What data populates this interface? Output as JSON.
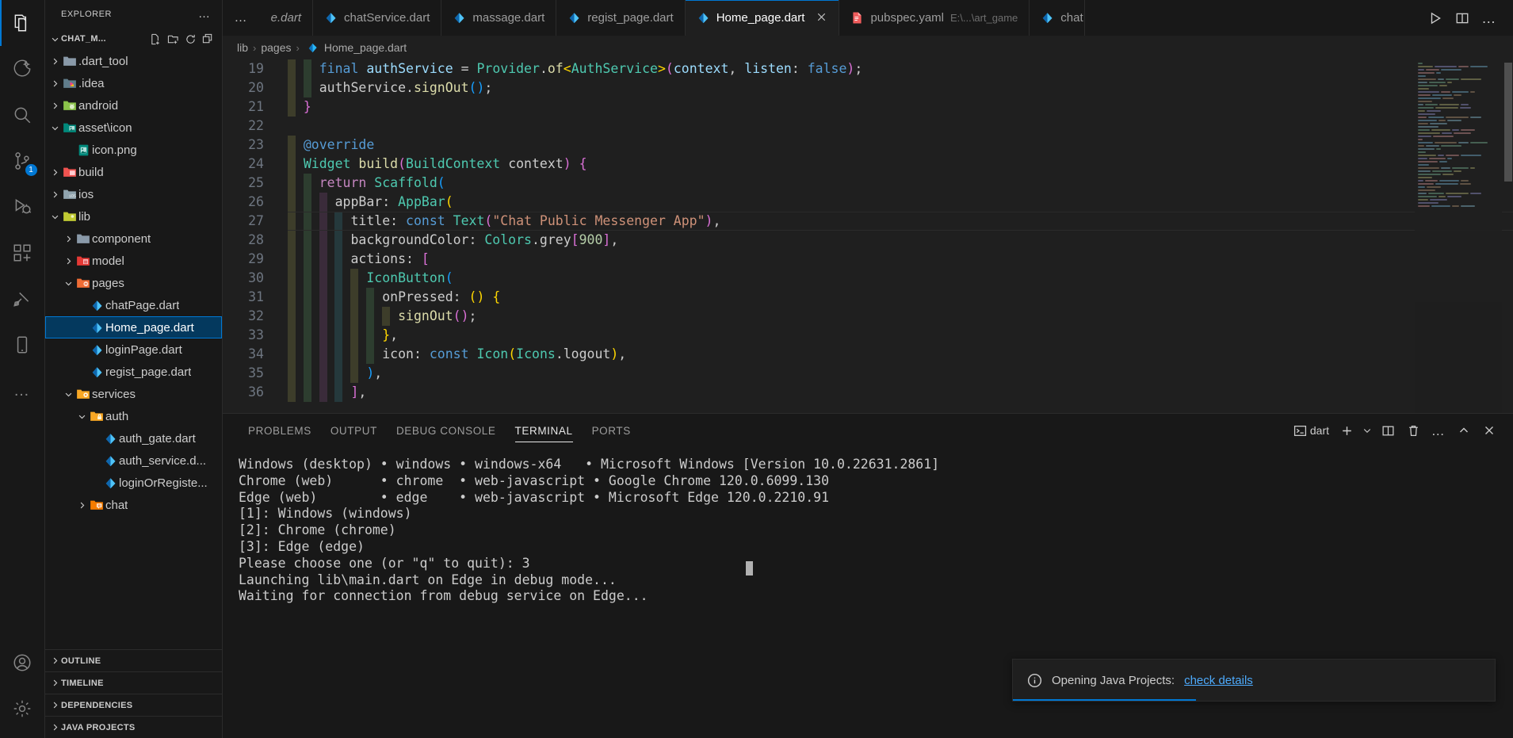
{
  "activitybar": {
    "items": [
      {
        "name": "explorer-icon",
        "active": true,
        "badge": ""
      },
      {
        "name": "github-copilot-icon",
        "active": false,
        "badge": ""
      },
      {
        "name": "search-icon",
        "active": false,
        "badge": ""
      },
      {
        "name": "source-control-icon",
        "active": false,
        "badge": "1"
      },
      {
        "name": "run-and-debug-icon",
        "active": false,
        "badge": ""
      },
      {
        "name": "extensions-icon",
        "active": false,
        "badge": ""
      },
      {
        "name": "testing-icon",
        "active": false,
        "badge": ""
      },
      {
        "name": "mobile-preview-icon",
        "active": false,
        "badge": ""
      },
      {
        "name": "more-views-icon",
        "active": false,
        "badge": ""
      }
    ],
    "bottom": [
      {
        "name": "accounts-icon"
      },
      {
        "name": "settings-gear-icon"
      }
    ]
  },
  "sidebar": {
    "title": "EXPLORER",
    "more_actions": "…",
    "root": {
      "label": "CHAT_M...",
      "actions": [
        "new-file-icon",
        "new-folder-icon",
        "refresh-icon",
        "collapse-all-icon"
      ]
    },
    "tree": [
      {
        "label": ".dart_tool",
        "indent": 1,
        "chevron": "right",
        "icon": "folder-plain",
        "selected": false
      },
      {
        "label": ".idea",
        "indent": 1,
        "chevron": "right",
        "icon": "folder-idea",
        "selected": false
      },
      {
        "label": "android",
        "indent": 1,
        "chevron": "right",
        "icon": "folder-android",
        "selected": false
      },
      {
        "label": "asset\\icon",
        "indent": 1,
        "chevron": "down",
        "icon": "folder-images",
        "selected": false
      },
      {
        "label": "icon.png",
        "indent": 2,
        "chevron": "none",
        "icon": "file-image",
        "selected": false
      },
      {
        "label": "build",
        "indent": 1,
        "chevron": "right",
        "icon": "folder-build",
        "selected": false
      },
      {
        "label": "ios",
        "indent": 1,
        "chevron": "right",
        "icon": "folder-ios",
        "selected": false
      },
      {
        "label": "lib",
        "indent": 1,
        "chevron": "down",
        "icon": "folder-lib",
        "selected": false
      },
      {
        "label": "component",
        "indent": 2,
        "chevron": "right",
        "icon": "folder-plain",
        "selected": false
      },
      {
        "label": "model",
        "indent": 2,
        "chevron": "right",
        "icon": "folder-model",
        "selected": false
      },
      {
        "label": "pages",
        "indent": 2,
        "chevron": "down",
        "icon": "folder-pages",
        "selected": false
      },
      {
        "label": "chatPage.dart",
        "indent": 3,
        "chevron": "none",
        "icon": "file-dart",
        "selected": false
      },
      {
        "label": "Home_page.dart",
        "indent": 3,
        "chevron": "none",
        "icon": "file-dart",
        "selected": true
      },
      {
        "label": "loginPage.dart",
        "indent": 3,
        "chevron": "none",
        "icon": "file-dart",
        "selected": false
      },
      {
        "label": "regist_page.dart",
        "indent": 3,
        "chevron": "none",
        "icon": "file-dart",
        "selected": false
      },
      {
        "label": "services",
        "indent": 2,
        "chevron": "down",
        "icon": "folder-services",
        "selected": false
      },
      {
        "label": "auth",
        "indent": 3,
        "chevron": "down",
        "icon": "folder-auth",
        "selected": false
      },
      {
        "label": "auth_gate.dart",
        "indent": 4,
        "chevron": "none",
        "icon": "file-dart",
        "selected": false
      },
      {
        "label": "auth_service.d...",
        "indent": 4,
        "chevron": "none",
        "icon": "file-dart",
        "selected": false
      },
      {
        "label": "loginOrRegiste...",
        "indent": 4,
        "chevron": "none",
        "icon": "file-dart",
        "selected": false
      },
      {
        "label": "chat",
        "indent": 3,
        "chevron": "right",
        "icon": "folder-chat",
        "selected": false
      }
    ],
    "bottom_sections": [
      "OUTLINE",
      "TIMELINE",
      "DEPENDENCIES",
      "JAVA PROJECTS"
    ]
  },
  "tabs": {
    "overflow_dots": "…",
    "items": [
      {
        "label": "e.dart",
        "desc": "",
        "icon": "file-dart",
        "active": false,
        "italic": true,
        "clipped": true,
        "close": false
      },
      {
        "label": "chatService.dart",
        "desc": "",
        "icon": "file-dart",
        "active": false,
        "italic": false,
        "clipped": false,
        "close": false
      },
      {
        "label": "massage.dart",
        "desc": "",
        "icon": "file-dart",
        "active": false,
        "italic": false,
        "clipped": false,
        "close": false
      },
      {
        "label": "regist_page.dart",
        "desc": "",
        "icon": "file-dart",
        "active": false,
        "italic": false,
        "clipped": false,
        "close": false
      },
      {
        "label": "Home_page.dart",
        "desc": "",
        "icon": "file-dart",
        "active": true,
        "italic": false,
        "clipped": false,
        "close": true
      },
      {
        "label": "pubspec.yaml",
        "desc": "E:\\...\\art_game",
        "icon": "file-yaml",
        "active": false,
        "italic": false,
        "clipped": false,
        "close": false
      },
      {
        "label": "chat",
        "desc": "",
        "icon": "file-dart",
        "active": false,
        "italic": false,
        "clipped": false,
        "close": false
      }
    ],
    "actions": [
      "run-play-icon",
      "split-editor-icon",
      "more-actions-icon"
    ]
  },
  "breadcrumbs": {
    "parts": [
      "lib",
      "pages",
      "Home_page.dart"
    ],
    "separator": "›"
  },
  "editor": {
    "first_line_number": 19,
    "lines": [
      {
        "n": 19,
        "current": false,
        "tokens": [
          {
            "t": "    ",
            "c": "pl"
          },
          {
            "t": "final",
            "c": "kw"
          },
          {
            "t": " ",
            "c": "pl"
          },
          {
            "t": "authService",
            "c": "var"
          },
          {
            "t": " = ",
            "c": "pl"
          },
          {
            "t": "Provider",
            "c": "type"
          },
          {
            "t": ".",
            "c": "pl"
          },
          {
            "t": "of",
            "c": "fn"
          },
          {
            "t": "<",
            "c": "p-y"
          },
          {
            "t": "AuthService",
            "c": "type"
          },
          {
            "t": ">",
            "c": "p-y"
          },
          {
            "t": "(",
            "c": "p-m"
          },
          {
            "t": "context",
            "c": "var"
          },
          {
            "t": ", ",
            "c": "pl"
          },
          {
            "t": "listen",
            "c": "var"
          },
          {
            "t": ": ",
            "c": "pl"
          },
          {
            "t": "false",
            "c": "kw"
          },
          {
            "t": ")",
            "c": "p-m"
          },
          {
            "t": ";",
            "c": "pl"
          }
        ]
      },
      {
        "n": 20,
        "current": false,
        "tokens": [
          {
            "t": "    ",
            "c": "pl"
          },
          {
            "t": "authService",
            "c": "pl"
          },
          {
            "t": ".",
            "c": "pl"
          },
          {
            "t": "signOut",
            "c": "fn"
          },
          {
            "t": "(",
            "c": "p-b"
          },
          {
            "t": ")",
            "c": "p-b"
          },
          {
            "t": ";",
            "c": "pl"
          }
        ]
      },
      {
        "n": 21,
        "current": false,
        "tokens": [
          {
            "t": "  ",
            "c": "pl"
          },
          {
            "t": "}",
            "c": "p-m"
          }
        ]
      },
      {
        "n": 22,
        "current": false,
        "tokens": []
      },
      {
        "n": 23,
        "current": false,
        "tokens": [
          {
            "t": "  ",
            "c": "pl"
          },
          {
            "t": "@override",
            "c": "ann"
          }
        ]
      },
      {
        "n": 24,
        "current": false,
        "tokens": [
          {
            "t": "  ",
            "c": "pl"
          },
          {
            "t": "Widget",
            "c": "type"
          },
          {
            "t": " ",
            "c": "pl"
          },
          {
            "t": "build",
            "c": "fn"
          },
          {
            "t": "(",
            "c": "p-m"
          },
          {
            "t": "BuildContext",
            "c": "type"
          },
          {
            "t": " ",
            "c": "pl"
          },
          {
            "t": "context",
            "c": "pl"
          },
          {
            "t": ")",
            "c": "p-m"
          },
          {
            "t": " ",
            "c": "pl"
          },
          {
            "t": "{",
            "c": "p-m"
          }
        ]
      },
      {
        "n": 25,
        "current": false,
        "tokens": [
          {
            "t": "    ",
            "c": "pl"
          },
          {
            "t": "return",
            "c": "kw2"
          },
          {
            "t": " ",
            "c": "pl"
          },
          {
            "t": "Scaffold",
            "c": "type"
          },
          {
            "t": "(",
            "c": "p-b"
          }
        ]
      },
      {
        "n": 26,
        "current": false,
        "tokens": [
          {
            "t": "      ",
            "c": "pl"
          },
          {
            "t": "appBar",
            "c": "pl"
          },
          {
            "t": ": ",
            "c": "pl"
          },
          {
            "t": "AppBar",
            "c": "type"
          },
          {
            "t": "(",
            "c": "p-y"
          }
        ]
      },
      {
        "n": 27,
        "current": true,
        "tokens": [
          {
            "t": "        ",
            "c": "pl"
          },
          {
            "t": "title",
            "c": "pl"
          },
          {
            "t": ": ",
            "c": "pl"
          },
          {
            "t": "const",
            "c": "kw"
          },
          {
            "t": " ",
            "c": "pl"
          },
          {
            "t": "Text",
            "c": "type"
          },
          {
            "t": "(",
            "c": "p-m"
          },
          {
            "t": "\"Chat Public Messenger App\"",
            "c": "str"
          },
          {
            "t": ")",
            "c": "p-m"
          },
          {
            "t": ",",
            "c": "pl"
          }
        ]
      },
      {
        "n": 28,
        "current": false,
        "tokens": [
          {
            "t": "        ",
            "c": "pl"
          },
          {
            "t": "backgroundColor",
            "c": "pl"
          },
          {
            "t": ": ",
            "c": "pl"
          },
          {
            "t": "Colors",
            "c": "type"
          },
          {
            "t": ".",
            "c": "pl"
          },
          {
            "t": "grey",
            "c": "pl"
          },
          {
            "t": "[",
            "c": "p-m"
          },
          {
            "t": "900",
            "c": "num"
          },
          {
            "t": "]",
            "c": "p-m"
          },
          {
            "t": ",",
            "c": "pl"
          }
        ]
      },
      {
        "n": 29,
        "current": false,
        "tokens": [
          {
            "t": "        ",
            "c": "pl"
          },
          {
            "t": "actions",
            "c": "pl"
          },
          {
            "t": ": ",
            "c": "pl"
          },
          {
            "t": "[",
            "c": "p-m"
          }
        ]
      },
      {
        "n": 30,
        "current": false,
        "tokens": [
          {
            "t": "          ",
            "c": "pl"
          },
          {
            "t": "IconButton",
            "c": "type"
          },
          {
            "t": "(",
            "c": "p-b"
          }
        ]
      },
      {
        "n": 31,
        "current": false,
        "tokens": [
          {
            "t": "            ",
            "c": "pl"
          },
          {
            "t": "onPressed",
            "c": "pl"
          },
          {
            "t": ": ",
            "c": "pl"
          },
          {
            "t": "(",
            "c": "p-y"
          },
          {
            "t": ")",
            "c": "p-y"
          },
          {
            "t": " ",
            "c": "pl"
          },
          {
            "t": "{",
            "c": "p-y"
          }
        ]
      },
      {
        "n": 32,
        "current": false,
        "tokens": [
          {
            "t": "              ",
            "c": "pl"
          },
          {
            "t": "signOut",
            "c": "fn"
          },
          {
            "t": "(",
            "c": "p-m"
          },
          {
            "t": ")",
            "c": "p-m"
          },
          {
            "t": ";",
            "c": "pl"
          }
        ]
      },
      {
        "n": 33,
        "current": false,
        "tokens": [
          {
            "t": "            ",
            "c": "pl"
          },
          {
            "t": "}",
            "c": "p-y"
          },
          {
            "t": ",",
            "c": "pl"
          }
        ]
      },
      {
        "n": 34,
        "current": false,
        "tokens": [
          {
            "t": "            ",
            "c": "pl"
          },
          {
            "t": "icon",
            "c": "pl"
          },
          {
            "t": ": ",
            "c": "pl"
          },
          {
            "t": "const",
            "c": "kw"
          },
          {
            "t": " ",
            "c": "pl"
          },
          {
            "t": "Icon",
            "c": "type"
          },
          {
            "t": "(",
            "c": "p-y"
          },
          {
            "t": "Icons",
            "c": "type"
          },
          {
            "t": ".",
            "c": "pl"
          },
          {
            "t": "logout",
            "c": "pl"
          },
          {
            "t": ")",
            "c": "p-y"
          },
          {
            "t": ",",
            "c": "pl"
          }
        ]
      },
      {
        "n": 35,
        "current": false,
        "tokens": [
          {
            "t": "          ",
            "c": "pl"
          },
          {
            "t": ")",
            "c": "p-b"
          },
          {
            "t": ",",
            "c": "pl"
          }
        ]
      },
      {
        "n": 36,
        "current": false,
        "tokens": [
          {
            "t": "        ",
            "c": "pl"
          },
          {
            "t": "]",
            "c": "p-m"
          },
          {
            "t": ",",
            "c": "pl"
          }
        ]
      }
    ]
  },
  "panel": {
    "tabs": [
      {
        "label": "PROBLEMS",
        "active": false
      },
      {
        "label": "OUTPUT",
        "active": false
      },
      {
        "label": "DEBUG CONSOLE",
        "active": false
      },
      {
        "label": "TERMINAL",
        "active": true
      },
      {
        "label": "PORTS",
        "active": false
      }
    ],
    "actions": {
      "shell_label": "dart",
      "icons": [
        "terminal-icon",
        "new-terminal-plus-icon",
        "terminal-dropdown-icon",
        "split-terminal-icon",
        "kill-terminal-trash-icon",
        "panel-more-icon",
        "maximize-panel-icon",
        "close-panel-icon"
      ]
    },
    "terminal_lines": [
      "Windows (desktop) • windows • windows-x64   • Microsoft Windows [Version 10.0.22631.2861]",
      "Chrome (web)      • chrome  • web-javascript • Google Chrome 120.0.6099.130",
      "Edge (web)        • edge    • web-javascript • Microsoft Edge 120.0.2210.91",
      "[1]: Windows (windows)",
      "[2]: Chrome (chrome)",
      "[3]: Edge (edge)",
      "Please choose one (or \"q\" to quit): 3",
      "Launching lib\\main.dart on Edge in debug mode...",
      "Waiting for connection from debug service on Edge..."
    ]
  },
  "notification": {
    "icon": "info-icon",
    "message": "Opening Java Projects:",
    "link": "check details"
  },
  "colors": {
    "accent": "#0078d4",
    "selection": "#04395e",
    "editor_bg": "#1f1f1f",
    "chrome_bg": "#181818"
  }
}
